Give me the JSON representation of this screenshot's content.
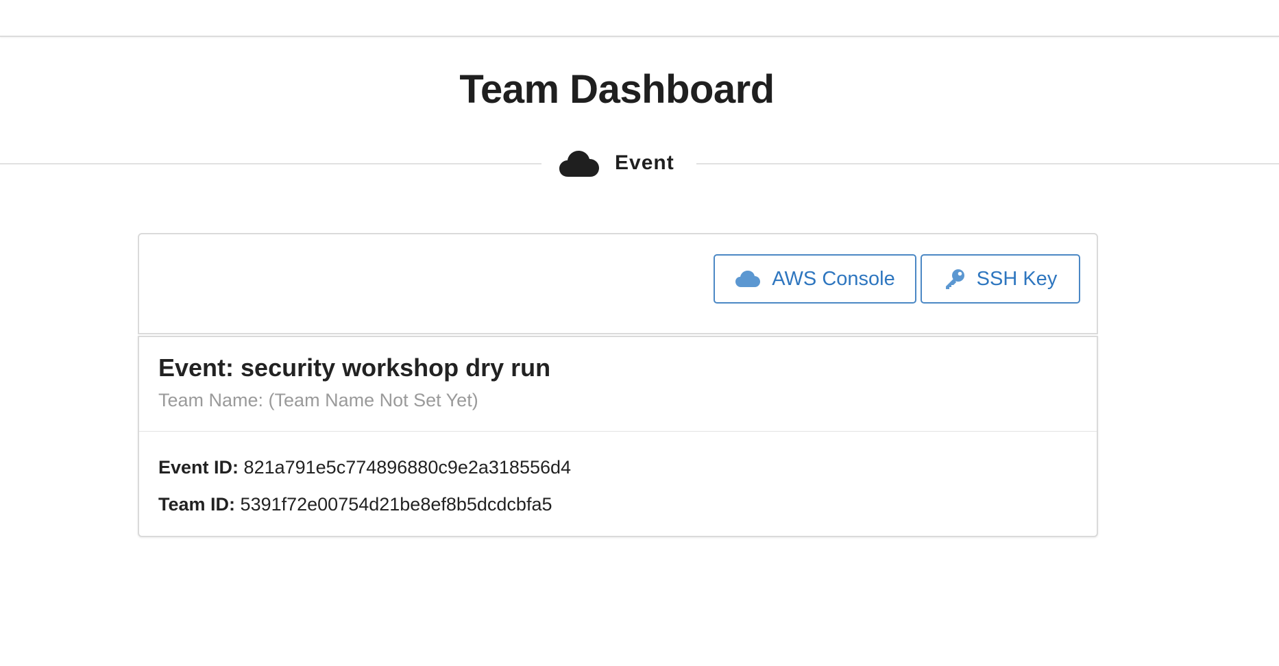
{
  "page": {
    "title": "Team Dashboard"
  },
  "section": {
    "icon": "cloud-icon",
    "label": "Event"
  },
  "toolbar": {
    "aws_console": {
      "label": "AWS Console",
      "icon": "cloud-icon"
    },
    "ssh_key": {
      "label": "SSH Key",
      "icon": "key-icon"
    }
  },
  "event": {
    "title": "Event: security workshop dry run",
    "team_name": "Team Name: (Team Name Not Set Yet)",
    "event_id_label": "Event ID:",
    "event_id": "821a791e5c774896880c9e2a318556d4",
    "team_id_label": "Team ID:",
    "team_id": "5391f72e00754d21be8ef8b5dcdcbfa5"
  },
  "colors": {
    "accent": "#2e76bf",
    "accent_icon": "#5b97d1",
    "text": "#222222",
    "muted": "#9a9a9a",
    "border": "#dadada"
  }
}
